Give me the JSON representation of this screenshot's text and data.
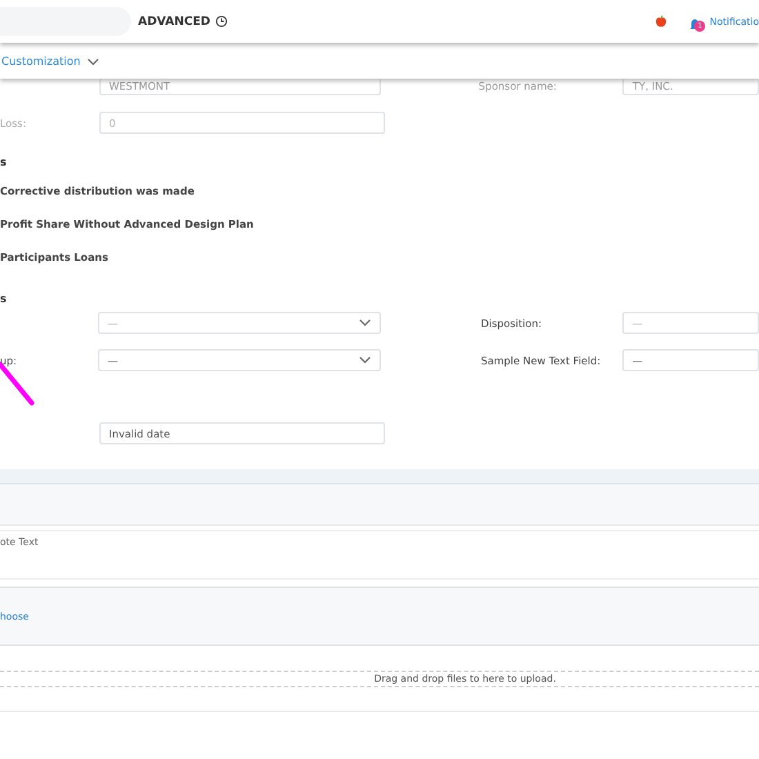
{
  "header": {
    "mode": "ADVANCED",
    "notification": {
      "label": "Notificatio",
      "badge": "1"
    }
  },
  "subnav": {
    "label": "Customization"
  },
  "faded_row": {
    "plan_value": "WESTMONT",
    "sponsor_label": "Sponsor name:",
    "sponsor_value": "TY, INC."
  },
  "loss": {
    "label": "Loss:",
    "placeholder": "0"
  },
  "section_1": {
    "heading": "s",
    "items": [
      {
        "label": "Corrective distribution was made"
      },
      {
        "label": "Profit Share Without Advanced Design Plan"
      },
      {
        "label": "Participants Loans"
      }
    ]
  },
  "section_2": {
    "heading": "s",
    "rows": [
      {
        "left": {
          "placeholder": "—",
          "kind": "select"
        },
        "right": {
          "label": "Disposition:",
          "placeholder": "—"
        }
      },
      {
        "left": {
          "label": "up:",
          "value": "—",
          "kind": "select"
        },
        "right": {
          "label": "Sample New Text Field:",
          "value": "—"
        }
      },
      {
        "left": {
          "value": "Invalid date",
          "kind": "input"
        }
      }
    ]
  },
  "note": {
    "label": "ote Text"
  },
  "attachments": {
    "choose_link": "hoose",
    "dropzone_text": "Drag and drop files to here to upload."
  }
}
